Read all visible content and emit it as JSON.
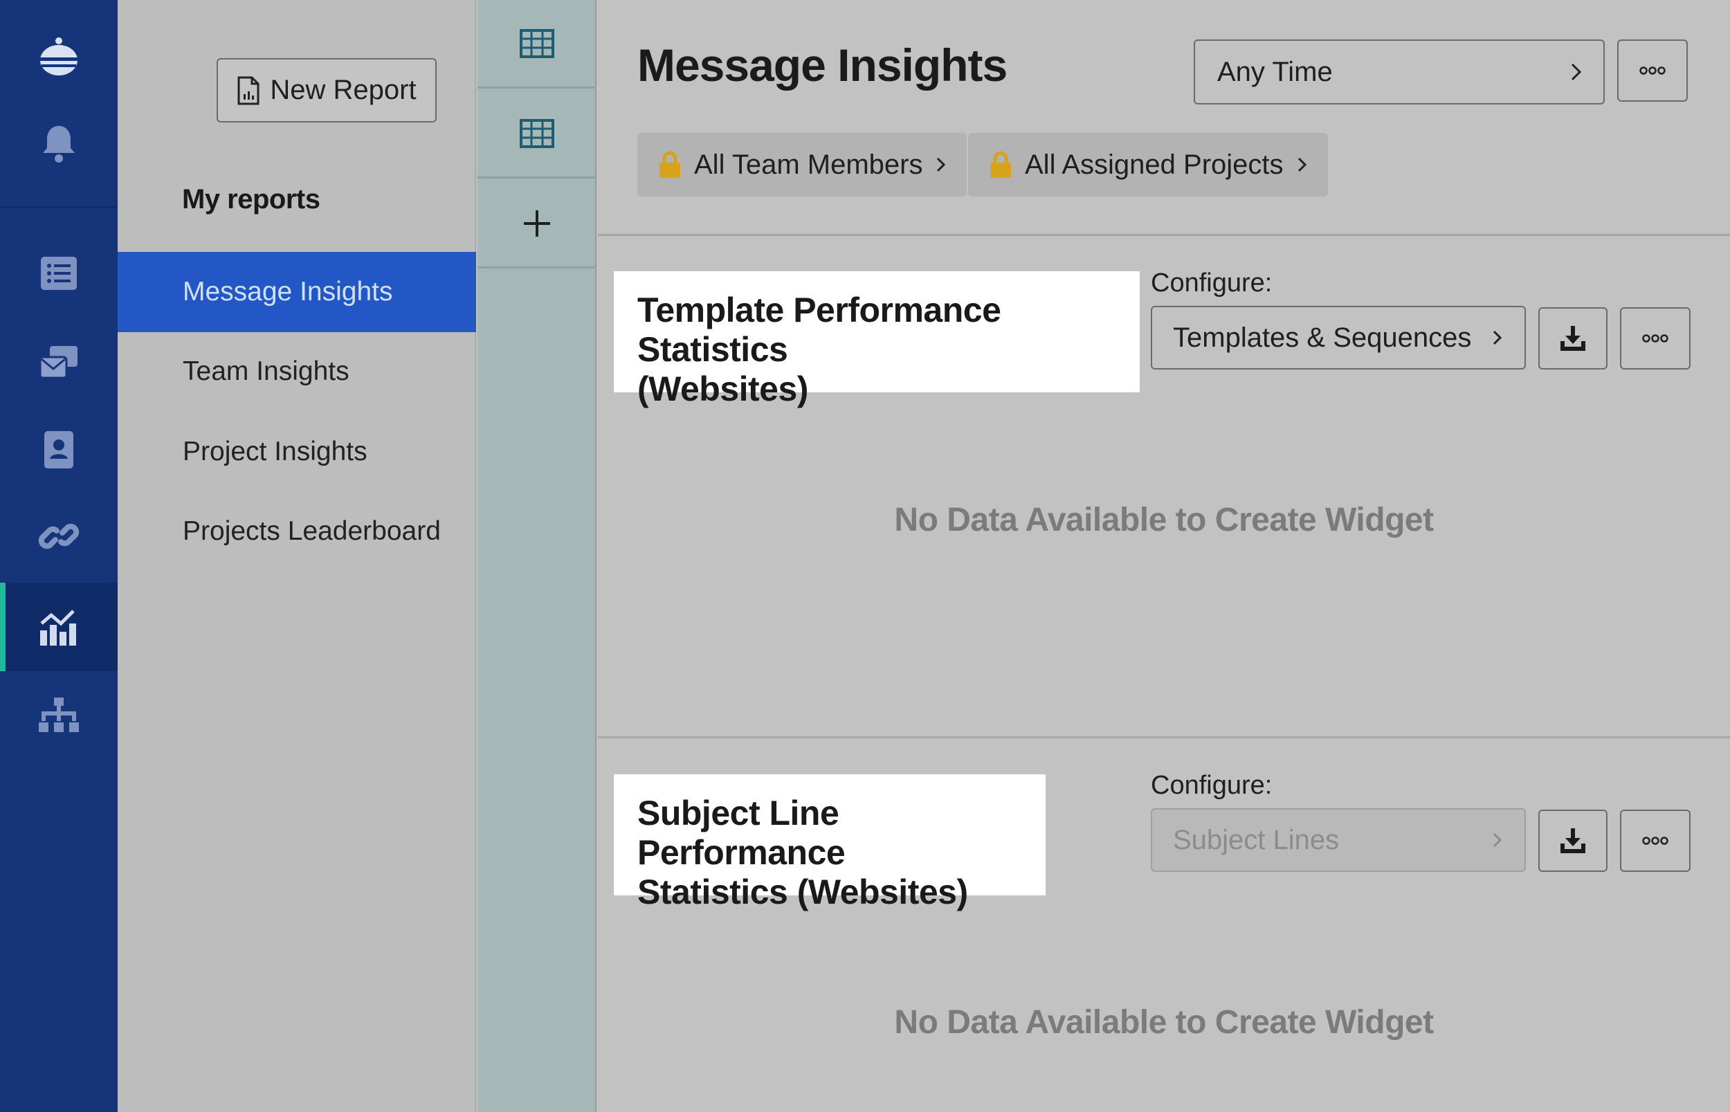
{
  "rail": {
    "icons": [
      "logo-icon",
      "bell-icon",
      "list-icon",
      "messages-icon",
      "contacts-icon",
      "link-icon",
      "chart-icon",
      "org-chart-icon"
    ],
    "active_color": "#1fb89a"
  },
  "reports_panel": {
    "new_report_label": "New Report",
    "section_title": "My reports",
    "items": [
      {
        "label": "Message Insights",
        "active": true
      },
      {
        "label": "Team Insights",
        "active": false
      },
      {
        "label": "Project Insights",
        "active": false
      },
      {
        "label": "Projects Leaderboard",
        "active": false
      }
    ]
  },
  "tabs": {
    "icons": [
      "table-icon",
      "table-icon",
      "plus-icon"
    ]
  },
  "header": {
    "title": "Message Insights",
    "time_filter": "Any Time",
    "filters": [
      "All Team Members",
      "All Assigned Projects"
    ]
  },
  "widgets": [
    {
      "title_line1": "Template Performance Statistics",
      "title_line2": "(Websites)",
      "configure_label": "Configure:",
      "configure_value": "Templates & Sequences",
      "configure_enabled": true,
      "empty_message": "No Data Available to Create Widget"
    },
    {
      "title_line1": "Subject Line Performance",
      "title_line2": "Statistics (Websites)",
      "configure_label": "Configure:",
      "configure_value": "Subject Lines",
      "configure_enabled": false,
      "empty_message": "No Data Available to Create Widget"
    }
  ],
  "colors": {
    "rail": "#16347a",
    "active_report": "#2357c5",
    "lock": "#d8a21c"
  }
}
